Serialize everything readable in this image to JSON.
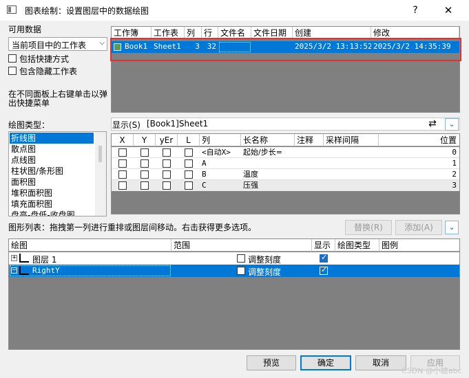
{
  "window": {
    "title": "图表绘制：设置图层中的数据绘图",
    "help": "?",
    "close": "✕"
  },
  "available": {
    "label": "可用数据",
    "source": "当前项目中的工作表",
    "include_shortcuts": "包括快捷方式",
    "include_hidden": "包含隐藏工作表",
    "hint_line1": "在不同面板上右键单击以弹",
    "hint_line2": "出快捷菜单"
  },
  "workbooks": {
    "columns": [
      "工作簿",
      "工作表",
      "列",
      "行",
      "文件名",
      "文件日期",
      "创建",
      "修改"
    ],
    "rows": [
      {
        "book": "Book1",
        "sheet": "Sheet1",
        "cols": "3",
        "rows": "32",
        "file": "",
        "filedate": "",
        "created": "2025/3/2 13:13:52",
        "modified": "2025/3/2 14:35:39"
      }
    ]
  },
  "plot_type": {
    "label": "绘图类型：",
    "items": [
      "折线图",
      "散点图",
      "点线图",
      "柱状图/条形图",
      "面积图",
      "堆积面积图",
      "填充面积图",
      "盘高-盘低-收盘图"
    ],
    "selected_index": 0
  },
  "columns_panel": {
    "show_label": "显示(S)",
    "sheet_ref": "[Book1]Sheet1",
    "headers": [
      "X",
      "Y",
      "yEr",
      "L",
      "列",
      "长名称",
      "注释",
      "采样间隔",
      "位置"
    ],
    "rows": [
      {
        "col": "<自动X>",
        "long_name": "起始/步长=",
        "position": "0"
      },
      {
        "col": "A",
        "long_name": "",
        "position": "1"
      },
      {
        "col": "B",
        "long_name": "温度",
        "position": "2"
      },
      {
        "col": "C",
        "long_name": "压强",
        "position": "3"
      }
    ]
  },
  "graph_list": {
    "label": "图形列表：拖拽第一列进行重排或图层间移动。右击获得更多选项。",
    "replace": "替换(R)",
    "add": "添加(A)",
    "headers": [
      "绘图",
      "范围",
      "显示",
      "绘图类型",
      "图例"
    ],
    "rows": [
      {
        "name": "图层 1",
        "range_label": "调整刻度",
        "shown": true
      },
      {
        "name": "RightY",
        "range_label": "调整刻度",
        "shown": true
      }
    ]
  },
  "footer": {
    "preview": "预览",
    "ok": "确定",
    "cancel": "取消",
    "apply": "应用",
    "watermark": "CSDN @小雄abc"
  }
}
